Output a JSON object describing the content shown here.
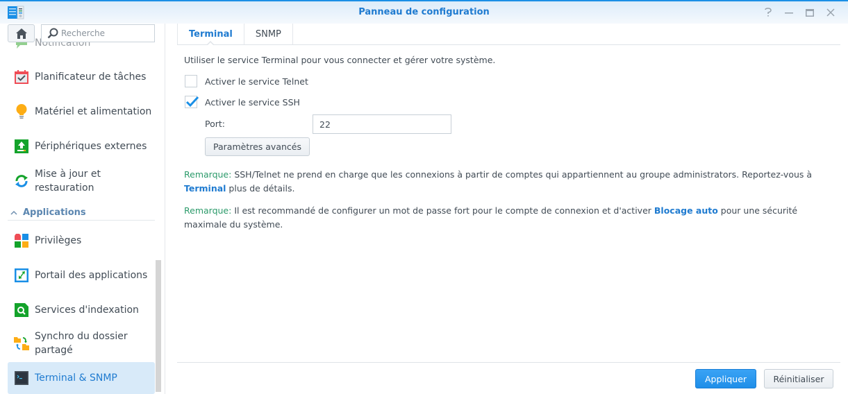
{
  "window": {
    "title": "Panneau de configuration",
    "controls": [
      "help-icon",
      "minimize-icon",
      "maximize-icon",
      "close-icon"
    ]
  },
  "sidebar": {
    "search_placeholder": "Recherche",
    "partial_item": "Notification",
    "items": [
      {
        "label": "Planificateur de tâches",
        "icon": "calendar-check-icon"
      },
      {
        "label": "Matériel et alimentation",
        "icon": "lightbulb-icon"
      },
      {
        "label": "Périphériques externes",
        "icon": "external-device-icon"
      },
      {
        "label": "Mise à jour et restauration",
        "icon": "update-restore-icon"
      }
    ],
    "section": {
      "label": "Applications",
      "expanded": true
    },
    "app_items": [
      {
        "label": "Privilèges",
        "icon": "privileges-icon"
      },
      {
        "label": "Portail des applications",
        "icon": "app-portal-icon"
      },
      {
        "label": "Services d'indexation",
        "icon": "indexing-icon"
      },
      {
        "label": "Synchro du dossier partagé",
        "icon": "shared-folder-sync-icon"
      },
      {
        "label": "Terminal & SNMP",
        "icon": "terminal-icon",
        "active": true
      }
    ]
  },
  "main": {
    "tabs": [
      {
        "label": "Terminal",
        "active": true
      },
      {
        "label": "SNMP",
        "active": false
      }
    ],
    "description": "Utiliser le service Terminal pour vous connecter et gérer votre système.",
    "telnet": {
      "label": "Activer le service Telnet",
      "checked": false
    },
    "ssh": {
      "label": "Activer le service SSH",
      "checked": true
    },
    "port": {
      "label": "Port:",
      "value": "22"
    },
    "advanced_button": "Paramètres avancés",
    "note1": {
      "prefix": "Remarque:",
      "text": " SSH/Telnet ne prend en charge que les connexions à partir de comptes qui appartiennent au groupe administrators. Reportez-vous à ",
      "link": "Terminal",
      "suffix": " plus de détails."
    },
    "note2": {
      "prefix": "Remarque:",
      "text": " Il est recommandé de configurer un mot de passe fort pour le compte de connexion et d'activer ",
      "link": "Blocage auto",
      "suffix": " pour une sécurité maximale du système."
    },
    "apply_button": "Appliquer",
    "reset_button": "Réinitialiser"
  },
  "colors": {
    "accent": "#1f7bd0",
    "remark": "#2b9a6a",
    "active_bg": "#d8eaf9"
  }
}
